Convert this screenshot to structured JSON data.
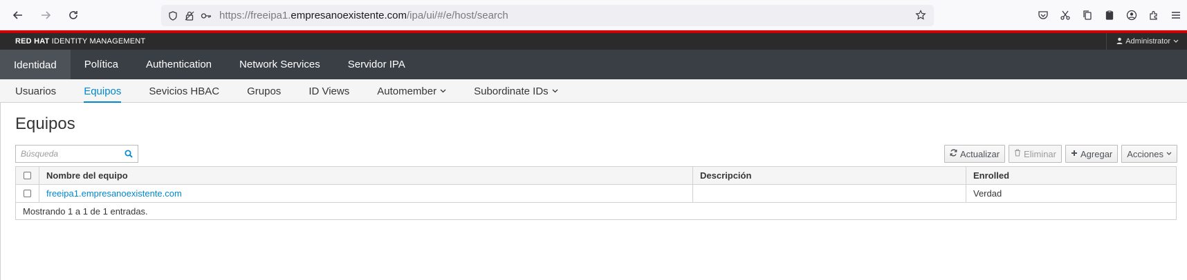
{
  "browser": {
    "url_prefix": "https://freeipa1.",
    "url_host": "empresanoexistente.com",
    "url_path": "/ipa/ui/#/e/host/search"
  },
  "brand": {
    "red_hat": "RED HAT",
    "product": " IDENTITY MANAGEMENT",
    "user": "Administrator"
  },
  "main_nav": [
    {
      "label": "Identidad",
      "active": true
    },
    {
      "label": "Política"
    },
    {
      "label": "Authentication"
    },
    {
      "label": "Network Services"
    },
    {
      "label": "Servidor IPA"
    }
  ],
  "sub_nav": [
    {
      "label": "Usuarios"
    },
    {
      "label": "Equipos",
      "active": true
    },
    {
      "label": "Sevicios HBAC"
    },
    {
      "label": "Grupos"
    },
    {
      "label": "ID Views"
    },
    {
      "label": "Automember",
      "dropdown": true
    },
    {
      "label": "Subordinate IDs",
      "dropdown": true
    }
  ],
  "page": {
    "title": "Equipos",
    "search_placeholder": "Búsqueda"
  },
  "actions": {
    "refresh": "Actualizar",
    "delete": "Eliminar",
    "add": "Agregar",
    "more": "Acciones"
  },
  "table": {
    "columns": [
      "Nombre del equipo",
      "Descripción",
      "Enrolled"
    ],
    "rows": [
      {
        "name": "freeipa1.empresanoexistente.com",
        "description": "",
        "enrolled": "Verdad"
      }
    ],
    "footer": "Mostrando 1 a 1 de 1 entradas."
  },
  "colors": {
    "accent": "#0088ce",
    "header_red": "#cc0000",
    "nav_bg": "#393f44"
  }
}
